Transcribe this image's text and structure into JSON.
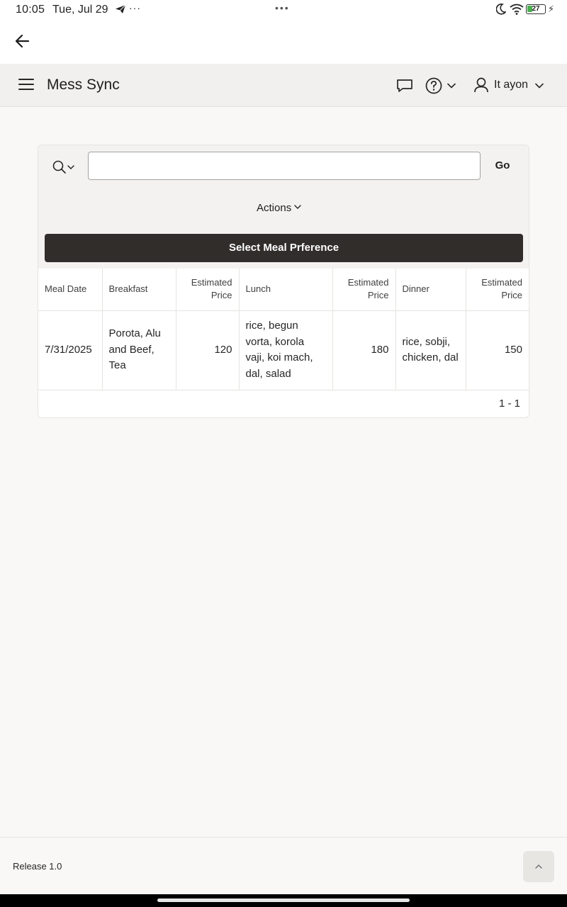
{
  "status_bar": {
    "time": "10:05",
    "date": "Tue, Jul 29",
    "more": "···",
    "center_dots": "•••",
    "battery_level": "27",
    "icons": [
      "telegram-send-icon",
      "moon-icon",
      "wifi-icon",
      "battery-icon",
      "charging-bolt-icon"
    ]
  },
  "app": {
    "title": "Mess Sync",
    "user_name": "It ayon"
  },
  "toolbar": {
    "search_value": "",
    "go_label": "Go",
    "actions_label": "Actions",
    "select_button_label": "Select Meal Prference"
  },
  "table": {
    "headers": [
      "Meal Date",
      "Breakfast",
      "Estimated Price",
      "Lunch",
      "Estimated Price",
      "Dinner",
      "Estimated Price"
    ],
    "rows": [
      [
        "7/31/2025",
        "Porota, Alu and Beef, Tea",
        "120",
        "rice, begun vorta, korola vaji, koi mach, dal, salad",
        "180",
        "rice, sobji, chicken, dal",
        "150"
      ]
    ],
    "pagination": "1 - 1"
  },
  "footer": {
    "release": "Release 1.0"
  },
  "colors": {
    "primary_button": "#312d2a",
    "header_bg": "#f1f0ee",
    "page_bg": "#f9f8f6"
  }
}
